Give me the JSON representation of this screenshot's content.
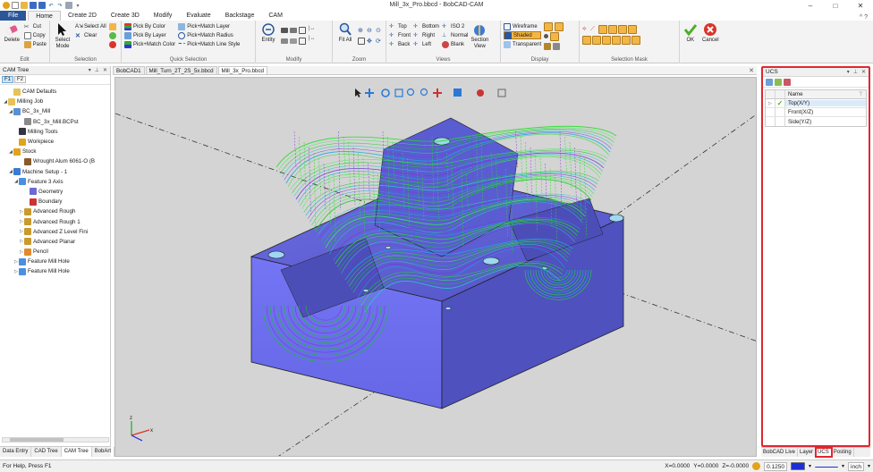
{
  "window": {
    "title": "Mill_3x_Pro.bbcd - BobCAD-CAM",
    "minimize": "–",
    "maximize": "□",
    "close": "✕"
  },
  "ribbon_tabs": [
    {
      "label": "File"
    },
    {
      "label": "Home"
    },
    {
      "label": "Create 2D"
    },
    {
      "label": "Create 3D"
    },
    {
      "label": "Modify"
    },
    {
      "label": "Evaluate"
    },
    {
      "label": "Backstage"
    },
    {
      "label": "CAM"
    }
  ],
  "ribbon": {
    "edit": {
      "label": "Edit",
      "delete": "Delete",
      "cut": "Cut",
      "copy": "Copy",
      "paste": "Paste"
    },
    "selection": {
      "label": "Selection",
      "select_mode": "Select Mode",
      "select_all": "Select All",
      "clear": "Clear"
    },
    "quick_selection": {
      "label": "Quick Selection",
      "items": [
        "Pick By Color",
        "Pick By Layer",
        "Pick+Match Color",
        "Pick+Match Layer",
        "Pick+Match Radius",
        "Pick+Match Line Style"
      ]
    },
    "modify": {
      "label": "Modify",
      "entity": "Entity"
    },
    "zoom": {
      "label": "Zoom",
      "fit_all": "Fit All"
    },
    "views": {
      "label": "Views",
      "items": [
        "Top",
        "Front",
        "Back",
        "Bottom",
        "Right",
        "Left",
        "ISO 2",
        "Normal",
        "Blank"
      ],
      "section_view": "Section View"
    },
    "display": {
      "label": "Display",
      "wireframe": "Wireframe",
      "shaded": "Shaded",
      "transparent": "Transparent"
    },
    "selection_mask": {
      "label": "Selection Mask",
      "ok": "OK",
      "cancel": "Cancel"
    }
  },
  "cam_tree": {
    "title": "CAM Tree",
    "filters": [
      "F1",
      "F2"
    ],
    "nodes": [
      {
        "label": "CAM Defaults",
        "indent": 1,
        "expander": "",
        "icon": "folder-icon"
      },
      {
        "label": "Milling Job",
        "indent": 0,
        "expander": "◢",
        "icon": "folder-icon"
      },
      {
        "label": "BC_3x_Mill",
        "indent": 1,
        "expander": "◢",
        "icon": "machine-icon"
      },
      {
        "label": "BC_3x_Mill.BCPst",
        "indent": 3,
        "expander": "",
        "icon": "post-icon"
      },
      {
        "label": "Milling Tools",
        "indent": 2,
        "expander": "",
        "icon": "tool-icon"
      },
      {
        "label": "Workpiece",
        "indent": 2,
        "expander": "",
        "icon": "workpiece-icon"
      },
      {
        "label": "Stock",
        "indent": 1,
        "expander": "◢",
        "icon": "stock-icon"
      },
      {
        "label": "Wrought Alum 6061-O (B",
        "indent": 3,
        "expander": "",
        "icon": "material-icon"
      },
      {
        "label": "Machine Setup - 1",
        "indent": 1,
        "expander": "◢",
        "icon": "setup-icon"
      },
      {
        "label": "Feature 3 Axis",
        "indent": 2,
        "expander": "◢",
        "icon": "feature-icon"
      },
      {
        "label": "Geometry",
        "indent": 4,
        "expander": "",
        "icon": "geometry-icon"
      },
      {
        "label": "Boundary",
        "indent": 4,
        "expander": "",
        "icon": "boundary-icon"
      },
      {
        "label": "Advanced Rough",
        "indent": 3,
        "expander": "▷",
        "icon": "operation-icon"
      },
      {
        "label": "Advanced Rough 1",
        "indent": 3,
        "expander": "▷",
        "icon": "operation-icon"
      },
      {
        "label": "Advanced Z Level Fini",
        "indent": 3,
        "expander": "▷",
        "icon": "operation-icon"
      },
      {
        "label": "Advanced Planar",
        "indent": 3,
        "expander": "▷",
        "icon": "operation-icon"
      },
      {
        "label": "Pencil",
        "indent": 3,
        "expander": "▷",
        "icon": "pencil-icon"
      },
      {
        "label": "Feature Mill Hole",
        "indent": 2,
        "expander": "▷",
        "icon": "feature-icon"
      },
      {
        "label": "Feature Mill Hole",
        "indent": 2,
        "expander": "▷",
        "icon": "feature-icon"
      }
    ],
    "bottom_tabs": [
      "Data Entry",
      "CAD Tree",
      "CAM Tree",
      "BobArt"
    ]
  },
  "documents": {
    "tabs": [
      "BobCAD1",
      "Mill_Turn_2T_2S_5x.bbcd",
      "Mill_3x_Pro.bbcd"
    ],
    "close": "✕"
  },
  "ucs_panel": {
    "title": "UCS",
    "column_name": "Name",
    "rows": [
      {
        "name": "Top(X/Y)",
        "active": true
      },
      {
        "name": "Front(X/Z)",
        "active": false
      },
      {
        "name": "Side(Y/Z)",
        "active": false
      }
    ],
    "bottom_tabs": [
      "BobCAD Live",
      "Layer",
      "UCS",
      "Posting"
    ]
  },
  "status": {
    "help": "For Help, Press F1",
    "x": "X=0.0000",
    "y": "Y=0.0000",
    "z": "Z=-0.0000",
    "step": "0.1250",
    "units": "inch"
  },
  "colors": {
    "accent": "#2b579a",
    "part_top": "#5c5fd6",
    "part_front": "#6e6fef",
    "part_side": "#3d3fa8",
    "toolpath_green": "#22dd22",
    "highlight_red": "#e0272f"
  }
}
